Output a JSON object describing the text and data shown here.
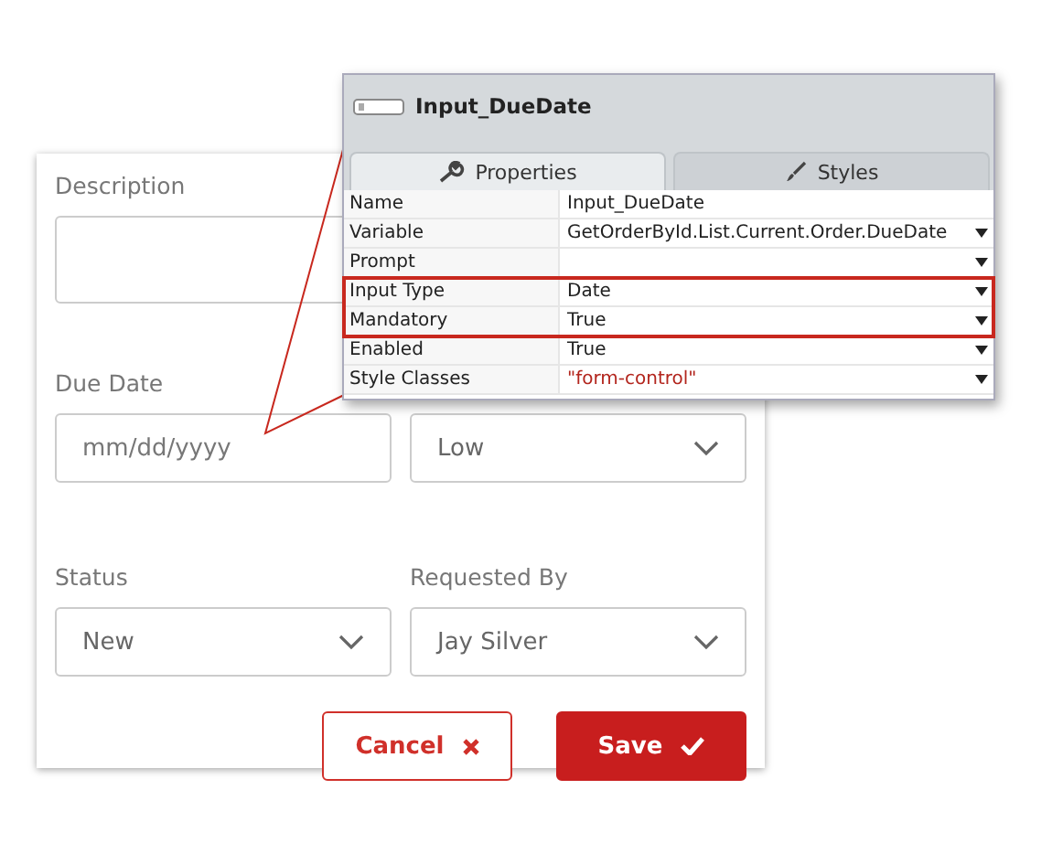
{
  "form": {
    "fields": [
      {
        "label": "Description",
        "kind": "textarea"
      },
      {
        "label": "Due Date",
        "kind": "date",
        "placeholder": "mm/dd/yyyy"
      },
      {
        "kind": "select",
        "value": "Low"
      },
      {
        "label": "Status",
        "kind": "select",
        "value": "New"
      },
      {
        "label": "Requested By",
        "kind": "select",
        "value": "Jay Silver"
      }
    ],
    "buttons": [
      {
        "label": "Cancel",
        "kind": "secondary"
      },
      {
        "label": "Save",
        "kind": "primary"
      }
    ]
  },
  "properties_panel": {
    "title": "Input_DueDate",
    "tabs": [
      {
        "label": "Properties",
        "selected": true
      },
      {
        "label": "Styles",
        "selected": false
      }
    ],
    "rows": [
      {
        "name": "Name",
        "value": "Input_DueDate",
        "dropdown": false,
        "highlighted": false,
        "kind": "plain"
      },
      {
        "name": "Variable",
        "value": "GetOrderById.List.Current.Order.DueDate",
        "dropdown": true,
        "highlighted": false,
        "kind": "plain"
      },
      {
        "name": "Prompt",
        "dropdown": true,
        "highlighted": false,
        "kind": "plain"
      },
      {
        "name": "Input Type",
        "value": "Date",
        "dropdown": true,
        "highlighted": true,
        "kind": "plain"
      },
      {
        "name": "Mandatory",
        "value": "True",
        "dropdown": true,
        "highlighted": true,
        "kind": "plain"
      },
      {
        "name": "Enabled",
        "value": "True",
        "dropdown": true,
        "highlighted": false,
        "kind": "plain"
      },
      {
        "name": "Style Classes",
        "value": "\"form-control\"",
        "dropdown": true,
        "highlighted": false,
        "kind": "literal"
      }
    ]
  }
}
